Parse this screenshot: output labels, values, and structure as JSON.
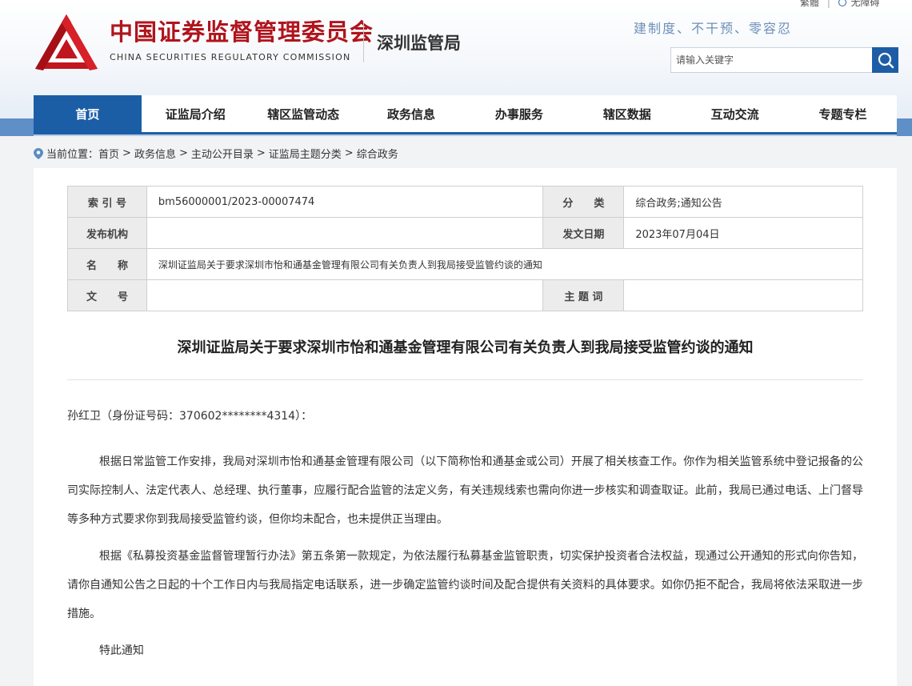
{
  "header": {
    "org_name_cn": "中国证券监督管理委员会",
    "org_name_en": "CHINA SECURITIES REGULATORY COMMISSION",
    "bureau_name": "深圳监管局",
    "slogan": "建制度、不干预、零容忍",
    "top_links": [
      "繁體",
      "无障碍"
    ],
    "search": {
      "placeholder": "请输入关键字"
    }
  },
  "colors": {
    "brand_red": "#b0141c",
    "nav_blue": "#1b5ea6"
  },
  "icons": {
    "search": "search-icon",
    "location": "location-pin-icon",
    "logo": "csrc-logo"
  },
  "nav": {
    "items": [
      "首页",
      "证监局介绍",
      "辖区监管动态",
      "政务信息",
      "办事服务",
      "辖区数据",
      "互动交流",
      "专题专栏"
    ],
    "active": "首页"
  },
  "breadcrumb": {
    "prefix": "当前位置：",
    "items": [
      "首页",
      "政务信息",
      "主动公开目录",
      "证监局主题分类",
      "综合政务"
    ]
  },
  "meta": {
    "index_label": "索 引 号",
    "index_value": "bm56000001/2023-00007474",
    "category_label": "分　　类",
    "category_value": "综合政务;通知公告",
    "publisher_label": "发布机构",
    "publisher_value": "",
    "date_label": "发文日期",
    "date_value": "2023年07月04日",
    "name_label": "名　　称",
    "name_value": "深圳证监局关于要求深圳市怡和通基金管理有限公司有关负责人到我局接受监管约谈的通知",
    "doc_no_label": "文　　号",
    "doc_no_value": "",
    "keywords_label": "主 题 词",
    "keywords_value": ""
  },
  "article": {
    "title": "深圳证监局关于要求深圳市怡和通基金管理有限公司有关负责人到我局接受监管约谈的通知",
    "salutation": "孙红卫（身份证号码：370602********4314）：",
    "paragraphs": [
      "根据日常监管工作安排，我局对深圳市怡和通基金管理有限公司（以下简称怡和通基金或公司）开展了相关核查工作。你作为相关监管系统中登记报备的公司实际控制人、法定代表人、总经理、执行董事，应履行配合监管的法定义务，有关违规线索也需向你进一步核实和调查取证。此前，我局已通过电话、上门督导等多种方式要求你到我局接受监管约谈，但你均未配合，也未提供正当理由。",
      "根据《私募投资基金监督管理暂行办法》第五条第一款规定，为依法履行私募基金监管职责，切实保护投资者合法权益，现通过公开通知的形式向你告知，请你自通知公告之日起的十个工作日内与我局指定电话联系，进一步确定监管约谈时间及配合提供有关资料的具体要求。如你仍拒不配合，我局将依法采取进一步措施。"
    ],
    "closing": "特此通知"
  }
}
